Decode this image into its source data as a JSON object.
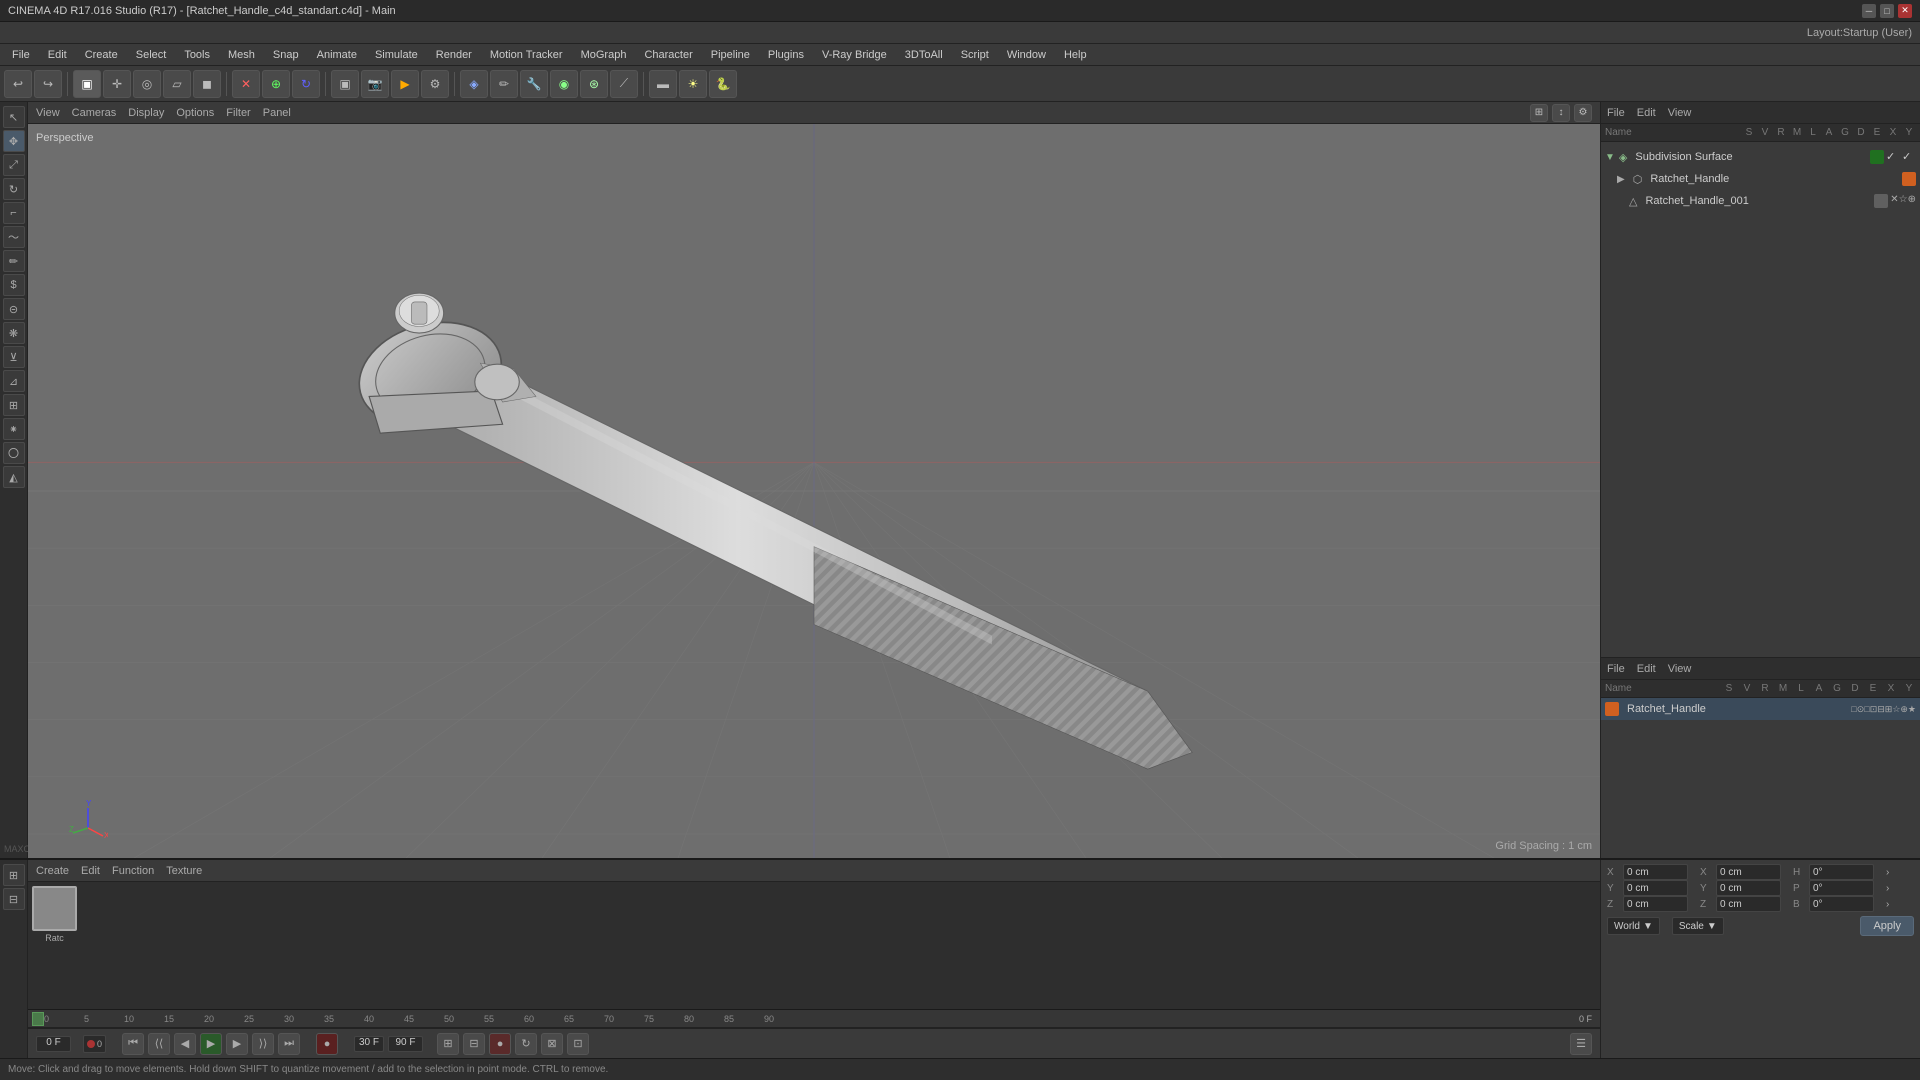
{
  "titlebar": {
    "title": "CINEMA 4D R17.016 Studio (R17) - [Ratchet_Handle_c4d_standart.c4d] - Main",
    "minimize": "─",
    "maximize": "□",
    "close": "✕"
  },
  "menubar": {
    "items": [
      "File",
      "Edit",
      "Create",
      "Select",
      "Tools",
      "Mesh",
      "Snap",
      "Animate",
      "Simulate",
      "Render",
      "Motion Tracker",
      "MoGraph",
      "Character",
      "Pipeline",
      "Plugins",
      "V-Ray Bridge",
      "3DToAll",
      "Script",
      "Window",
      "Help"
    ]
  },
  "layout": {
    "label": "Layout:",
    "value": "Startup (User)"
  },
  "viewport": {
    "perspective_label": "Perspective",
    "grid_spacing": "Grid Spacing : 1 cm",
    "header_items": [
      "View",
      "Cameras",
      "Display",
      "Options",
      "Filter",
      "Panel"
    ]
  },
  "object_manager": {
    "header_items": [
      "File",
      "Edit",
      "View"
    ],
    "cols": {
      "name": "Name",
      "s": "S",
      "v": "V",
      "r": "R",
      "m": "M",
      "l": "L",
      "a": "A",
      "g": "G",
      "d": "D",
      "e": "E",
      "x": "X",
      "y": "Y"
    },
    "objects": [
      {
        "name": "Subdivision Surface",
        "indent": 0,
        "icon": "◈",
        "dot_color": "green",
        "has_check": true
      },
      {
        "name": "Ratchet_Handle",
        "indent": 1,
        "icon": "▶",
        "dot_color": "orange",
        "has_check": false
      },
      {
        "name": "Ratchet_Handle_001",
        "indent": 2,
        "icon": "△",
        "dot_color": "gray",
        "has_check": false
      }
    ]
  },
  "attributes_manager": {
    "header_items": [
      "File",
      "Edit",
      "View"
    ],
    "name_label": "Name",
    "object_name": "Ratchet_Handle",
    "coords": {
      "x_label": "X",
      "x_val": "0 cm",
      "y_label": "Y",
      "y_val": "0 cm",
      "z_label": "Z",
      "z_val": "0 cm",
      "px_label": "P",
      "px_val": "0°",
      "py_label": "P",
      "py_val": "0°",
      "pz_label": "B",
      "pz_val": "0°",
      "sx_label": "H",
      "sx_val": "0°",
      "sy_label": "",
      "sy_val": "",
      "sz_label": "",
      "sz_val": ""
    },
    "coord_system": "World",
    "scale_mode": "Scale",
    "apply_btn": "Apply"
  },
  "timeline": {
    "header_items": [
      "Create",
      "Edit",
      "Function",
      "Texture"
    ],
    "start_frame": "0 F",
    "end_frame": "0 F",
    "fps": "30 F",
    "end_time": "90 F",
    "current_frame": "0 F",
    "ruler_marks": [
      "0",
      "5",
      "10",
      "15",
      "20",
      "25",
      "30",
      "35",
      "40",
      "45",
      "50",
      "55",
      "60",
      "65",
      "70",
      "75",
      "80",
      "85",
      "90"
    ]
  },
  "material": {
    "name": "Ratc",
    "swatch_color": "#888888"
  },
  "status_bar": {
    "text": "Move: Click and drag to move elements. Hold down SHIFT to quantize movement / add to the selection in point mode. CTRL to remove."
  },
  "icons": {
    "undo": "↩",
    "redo": "↪",
    "play": "▶",
    "stop": "■",
    "record": "●",
    "prev_frame": "◀",
    "next_frame": "▶",
    "first_frame": "⏮",
    "last_frame": "⏭",
    "loop": "↻"
  }
}
